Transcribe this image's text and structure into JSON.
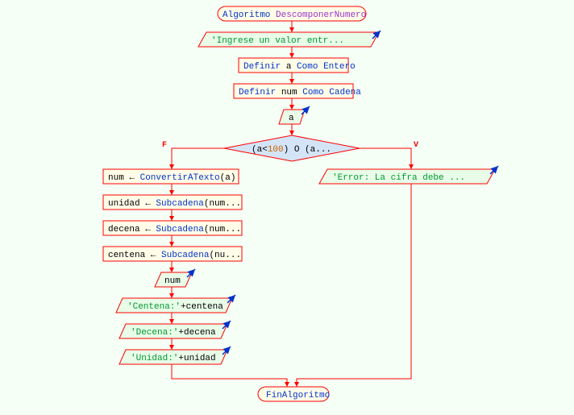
{
  "flowchart": {
    "start": {
      "kw1": "Algoritmo",
      "name": "DescomponerNumero"
    },
    "io_prompt": "'Ingrese un valor entr...",
    "def_a": {
      "p1": "Definir",
      "p2": "a",
      "p3": "Como",
      "p4": "Entero"
    },
    "def_num": {
      "p1": "Definir",
      "p2": "num",
      "p3": "Como",
      "p4": "Cadena"
    },
    "read_a": "a",
    "decision": {
      "p1": "(a<",
      "num": "100",
      "p2": ") O (a..."
    },
    "false_label": "F",
    "true_label": "V",
    "false_branch": {
      "conv": {
        "p1": "num ← ",
        "fn": "ConvertirATexto",
        "p2": "(a)"
      },
      "unidad": {
        "p1": "unidad ← ",
        "fn": "Subcadena",
        "p2": "(num..."
      },
      "decena": {
        "p1": "decena ← ",
        "fn": "Subcadena",
        "p2": "(num..."
      },
      "centena": {
        "p1": "centena ← ",
        "fn": "Subcadena",
        "p2": "(nu..."
      },
      "out_num": "num",
      "out_cent": {
        "s": "'Centena:'",
        "v": "+centena"
      },
      "out_dec": {
        "s": "'Decena:'",
        "v": "+decena"
      },
      "out_uni": {
        "s": "'Unidad:'",
        "v": "+unidad"
      }
    },
    "true_branch": {
      "err": "'Error: La cifra debe ..."
    },
    "end": "FinAlgoritmo"
  }
}
